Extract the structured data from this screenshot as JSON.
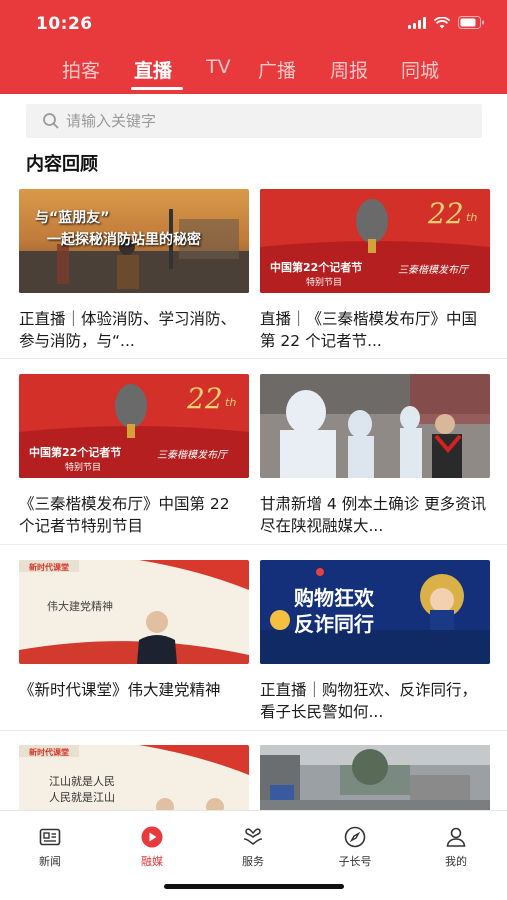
{
  "status_bar": {
    "time": "10:26"
  },
  "tabs": [
    {
      "label": "拍客",
      "active": false
    },
    {
      "label": "直播",
      "active": true
    },
    {
      "label": "TV",
      "active": false
    },
    {
      "label": "广播",
      "active": false
    },
    {
      "label": "周报",
      "active": false
    },
    {
      "label": "同城",
      "active": false
    }
  ],
  "search": {
    "placeholder": "请输入关键字"
  },
  "section": {
    "title": "内容回顾"
  },
  "thumbs": {
    "fire": {
      "line1": "与“蓝朋友”",
      "line2": "一起探秘消防站里的秘密"
    },
    "journalist": {
      "num": "22",
      "sup": "th",
      "main": "中国第22个记者节",
      "sub": "特别节目",
      "script": "三秦楷模发布厅"
    },
    "classroom": {
      "logo": "新时代课堂",
      "text": "伟大建党精神",
      "text2a": "江山就是人民",
      "text2b": "人民就是江山"
    },
    "shopping": {
      "line1": "购物狂欢",
      "line2": "反诈同行"
    }
  },
  "items": [
    {
      "title": "正直播｜体验消防、学习消防、参与消防，与“..."
    },
    {
      "title": "直播｜《三秦楷模发布厅》中国第 22 个记者节..."
    },
    {
      "title": "《三秦楷模发布厅》中国第 22 个记者节特别节目"
    },
    {
      "title": "甘肃新增 4 例本土确诊 更多资讯尽在陕视融媒大..."
    },
    {
      "title": "《新时代课堂》伟大建党精神"
    },
    {
      "title": "正直播｜购物狂欢、反诈同行，看子长民警如何..."
    }
  ],
  "bottom_nav": [
    {
      "label": "新闻",
      "icon": "newspaper-icon",
      "active": false
    },
    {
      "label": "融媒",
      "icon": "play-circle-icon",
      "active": true
    },
    {
      "label": "服务",
      "icon": "heart-hand-icon",
      "active": false
    },
    {
      "label": "子长号",
      "icon": "compass-icon",
      "active": false
    },
    {
      "label": "我的",
      "icon": "user-icon",
      "active": false
    }
  ],
  "colors": {
    "brand_red": "#e8393c",
    "text": "#1a1a1a"
  }
}
